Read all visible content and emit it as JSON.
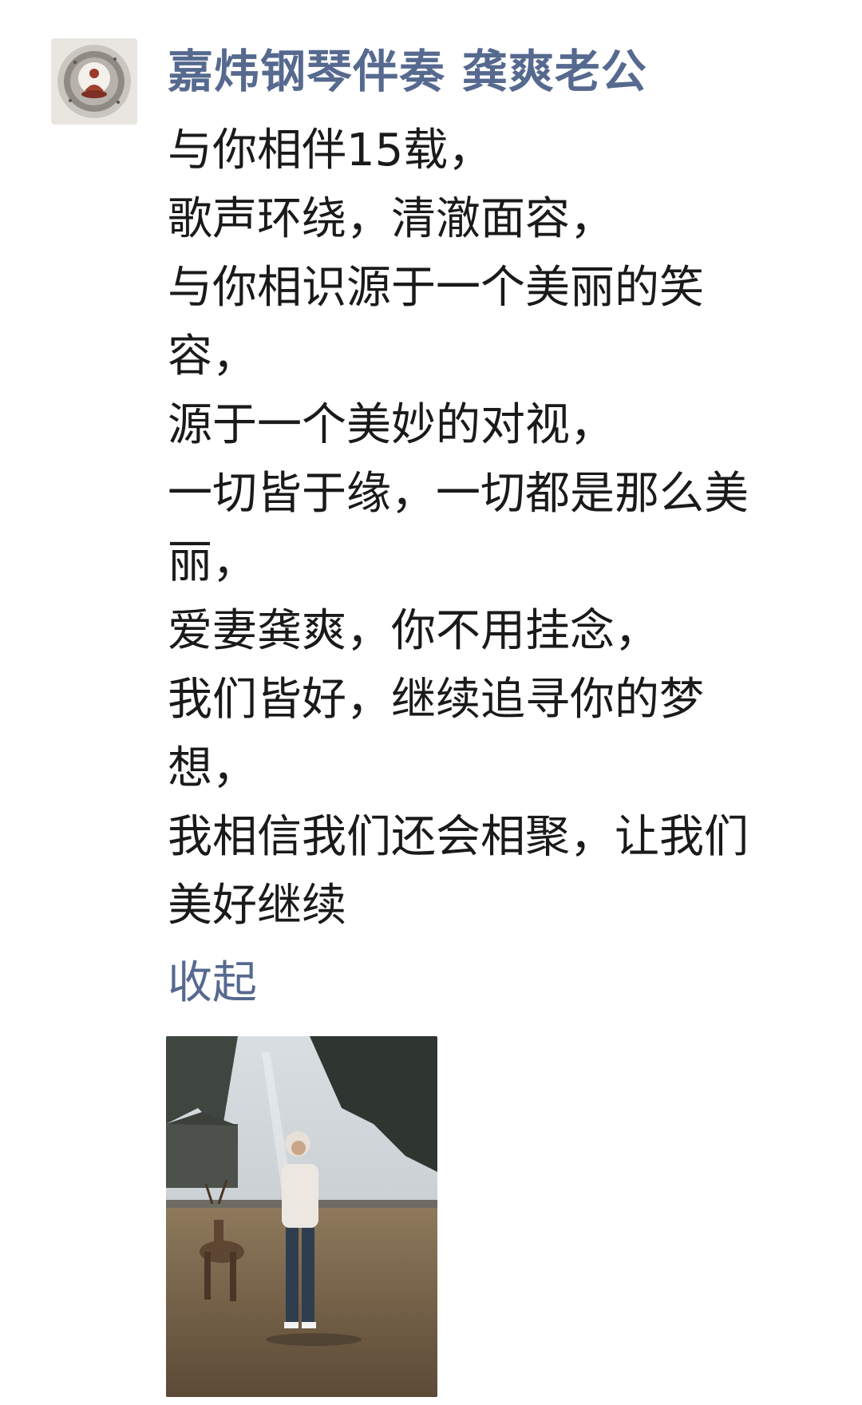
{
  "post": {
    "author": "嘉炜钢琴伴奏 龚爽老公",
    "lines": [
      "与你相伴15载，",
      "歌声环绕，清澈面容，",
      "与你相识源于一个美丽的笑",
      "容，",
      "源于一个美妙的对视，",
      "一切皆于缘，一切都是那么美",
      "丽，",
      "爱妻龚爽，你不用挂念，",
      "我们皆好，继续追寻你的梦",
      "想，",
      "我相信我们还会相聚，让我们",
      "美好继续"
    ],
    "collapse_label": "收起"
  },
  "colors": {
    "author": "#56698f",
    "text": "#1a1a1a",
    "link": "#56698f",
    "background": "#ffffff"
  },
  "icons": {
    "avatar": "meditating-buddha-avatar",
    "photo": "woman-with-deer-photo"
  }
}
